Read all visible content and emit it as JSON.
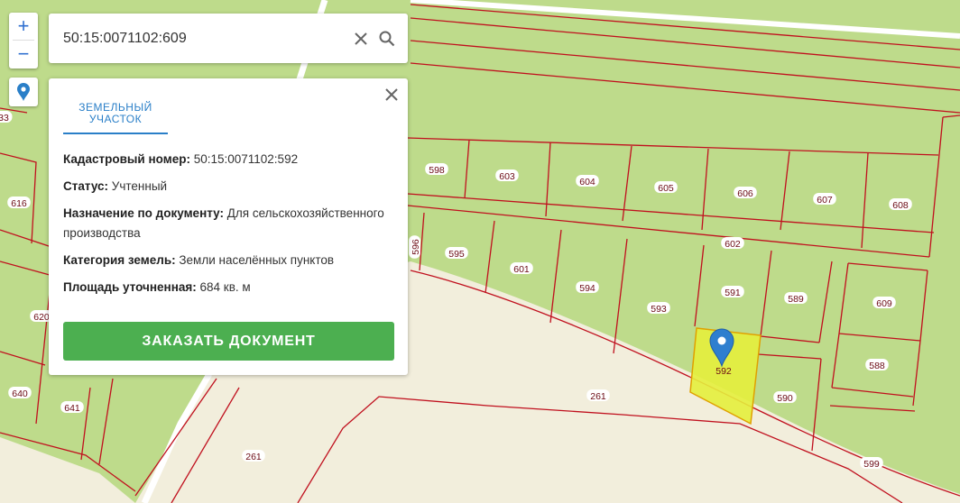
{
  "search": {
    "value": "50:15:0071102:609"
  },
  "zoom": {
    "plus": "+",
    "minus": "−"
  },
  "info": {
    "tab": "ЗЕМЕЛЬНЫЙ УЧАСТОК",
    "cadastral_label": "Кадастровый номер:",
    "cadastral_value": "50:15:0071102:592",
    "status_label": "Статус:",
    "status_value": "Учтенный",
    "purpose_label": "Назначение по документу:",
    "purpose_value": "Для сельскохозяйственного производства",
    "category_label": "Категория земель:",
    "category_value": "Земли населённых пунктов",
    "area_label": "Площадь уточненная:",
    "area_value": "684 кв. м",
    "order_button": "ЗАКАЗАТЬ ДОКУМЕНТ"
  },
  "map": {
    "plots": [
      {
        "id": "p33",
        "label": "33"
      },
      {
        "id": "p616",
        "label": "616"
      },
      {
        "id": "p620",
        "label": "620"
      },
      {
        "id": "p640",
        "label": "640"
      },
      {
        "id": "p641",
        "label": "641"
      },
      {
        "id": "p598",
        "label": "598"
      },
      {
        "id": "p603",
        "label": "603"
      },
      {
        "id": "p604",
        "label": "604"
      },
      {
        "id": "p605",
        "label": "605"
      },
      {
        "id": "p606",
        "label": "606"
      },
      {
        "id": "p607",
        "label": "607"
      },
      {
        "id": "p608",
        "label": "608"
      },
      {
        "id": "p602",
        "label": "602"
      },
      {
        "id": "p596",
        "label": "596"
      },
      {
        "id": "p595",
        "label": "595"
      },
      {
        "id": "p601",
        "label": "601"
      },
      {
        "id": "p594",
        "label": "594"
      },
      {
        "id": "p593",
        "label": "593"
      },
      {
        "id": "p591",
        "label": "591"
      },
      {
        "id": "p589",
        "label": "589"
      },
      {
        "id": "p609",
        "label": "609"
      },
      {
        "id": "p592",
        "label": "592"
      },
      {
        "id": "p588",
        "label": "588"
      },
      {
        "id": "p590",
        "label": "590"
      },
      {
        "id": "p599",
        "label": "599"
      },
      {
        "id": "p261a",
        "label": "261"
      },
      {
        "id": "p261b",
        "label": "261"
      }
    ],
    "colors": {
      "green": "#bedb8b",
      "road": "#f2eedc",
      "boundary": "#c0101e",
      "selected": "#e4ee3c"
    }
  }
}
